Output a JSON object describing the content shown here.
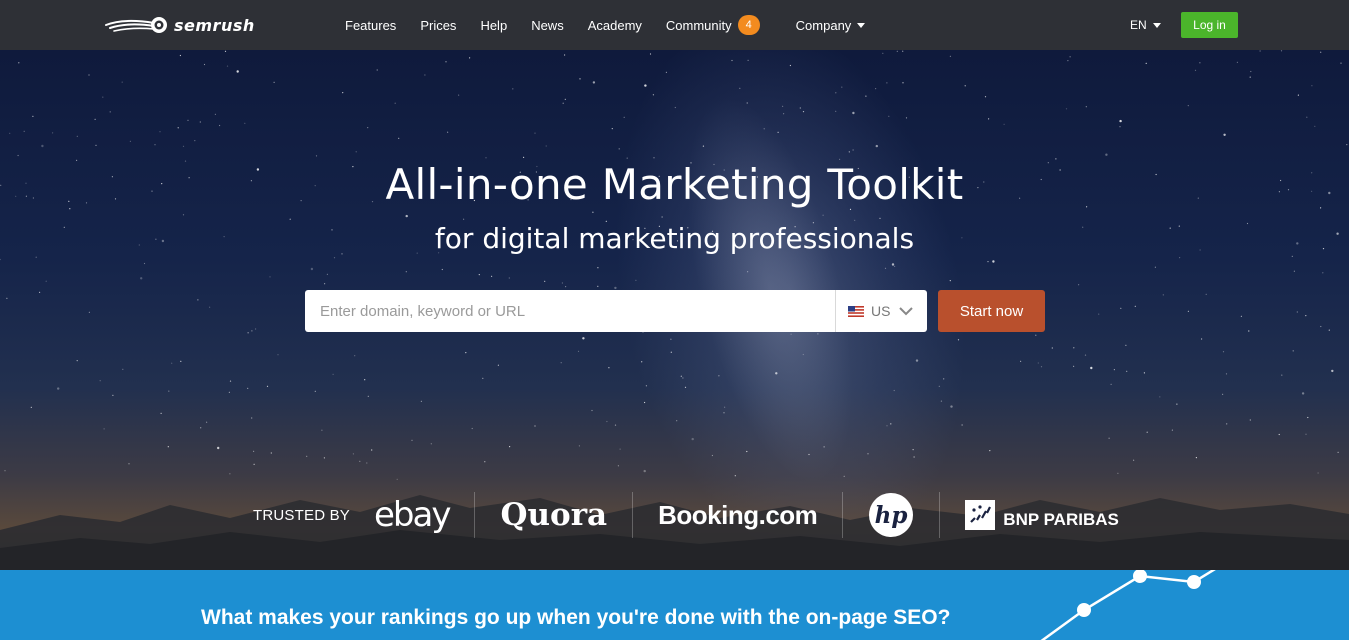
{
  "nav": {
    "logo_text": "semrush",
    "items": [
      {
        "label": "Features"
      },
      {
        "label": "Prices"
      },
      {
        "label": "Help"
      },
      {
        "label": "News"
      },
      {
        "label": "Academy"
      },
      {
        "label": "Community",
        "badge": "4"
      },
      {
        "label": "Company",
        "dropdown": true
      }
    ],
    "language": "EN",
    "login_label": "Log in"
  },
  "hero": {
    "title": "All-in-one Marketing Toolkit",
    "subtitle": "for digital marketing professionals",
    "search": {
      "placeholder": "Enter domain, keyword or URL",
      "value": "",
      "database": "US",
      "flag_icon": "us-flag-icon"
    },
    "start_label": "Start now"
  },
  "trusted": {
    "label": "TRUSTED BY",
    "brands": [
      "ebay",
      "Quora",
      "Booking.com",
      "hp",
      "BNP PARIBAS"
    ]
  },
  "band": {
    "title": "What makes your rankings go up when you're done with the on-page SEO?"
  },
  "colors": {
    "nav_bg": "#2e3036",
    "login_green": "#4bb52b",
    "start_orange": "#b9502d",
    "badge_orange": "#f38b1f",
    "band_blue": "#1d8fd2"
  }
}
